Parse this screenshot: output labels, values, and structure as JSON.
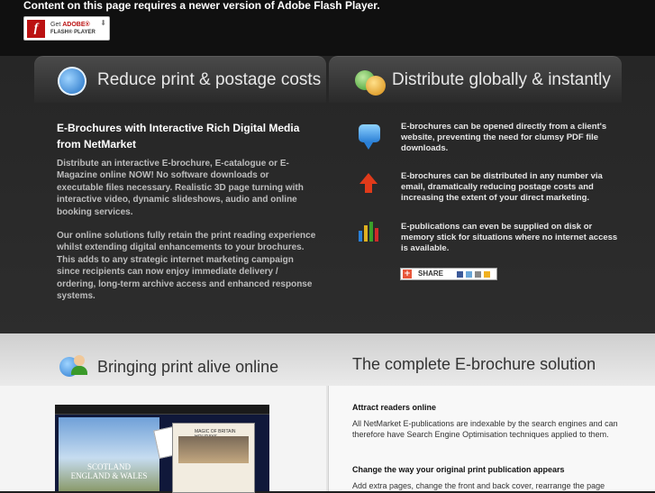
{
  "flash": {
    "message": "Content on this page requires a newer version of Adobe Flash Player.",
    "badge_line1_prefix": "Get ",
    "badge_line1_brand": "ADOBE®",
    "badge_line2": "FLASH® PLAYER"
  },
  "tabs": {
    "left_title": "Reduce print & postage costs",
    "right_title": "Distribute globally & instantly"
  },
  "left_column": {
    "heading": "E-Brochures with Interactive Rich Digital Media from NetMarket",
    "para1": "Distribute an interactive E-brochure, E-catalogue or E-Magazine online NOW! No software downloads or executable files necessary. Realistic 3D page turning with interactive video, dynamic slideshows, audio and online booking services.",
    "para2": "Our online solutions fully retain the print reading experience whilst extending digital enhancements to your brochures. This adds to any strategic internet marketing campaign since recipients can now enjoy immediate delivery / ordering, long-term archive access and enhanced response systems."
  },
  "features": [
    {
      "icon": "speech-bubble-icon",
      "text": "E-brochures can be opened directly from a client's website, preventing the need for clumsy PDF file downloads."
    },
    {
      "icon": "up-arrow-icon",
      "text": "E-brochures can be distributed in any number via email, dramatically reducing postage costs and increasing the extent of your direct marketing."
    },
    {
      "icon": "bar-chart-icon",
      "text": "E-publications can even be supplied on disk or memory stick for situations where no internet access is available."
    }
  ],
  "share": {
    "label": "SHARE"
  },
  "lower": {
    "left_title": "Bringing print alive online",
    "right_title": "The complete E-brochure solution",
    "book": {
      "cover_title": "SCOTLAND ENGLAND & WALES",
      "page_title": "MAGIC OF BRITAIN HOLIDAYS"
    },
    "items": [
      {
        "heading": "Attract readers online",
        "text": "All NetMarket E-publications are indexable by the search engines and can therefore have Search Engine Optimisation techniques applied to them."
      },
      {
        "heading": "Change the way your original print publication appears",
        "text": "Add extra pages, change the front and back cover, rearrange the page"
      }
    ]
  },
  "colors": {
    "accent_red": "#b11111",
    "dark_bg": "#262626",
    "light_bg": "#e6e6e6"
  }
}
